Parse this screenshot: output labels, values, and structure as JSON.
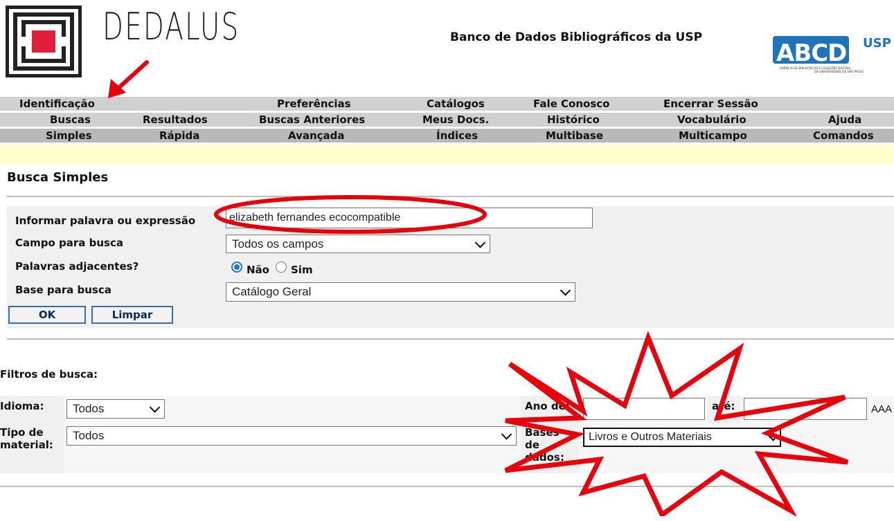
{
  "header": {
    "brand_name": "DEDALUS",
    "db_title": "Banco de Dados Bibliográficos da USP",
    "abcd_logo_text": "ABCD",
    "abcd_usp": "USP",
    "abcd_tagline_1": "AGÊNCIA DE BIBLIOTECAS E COLEÇÕES DIGITAIS",
    "abcd_tagline_2": "DA UNIVERSIDADE DE SÃO PAULO",
    "logo_color": "#e31e3a"
  },
  "menu": {
    "row1": [
      "Identificação",
      "Preferências",
      "Catálogos",
      "Fale Conosco",
      "Encerrar Sessão"
    ],
    "row2": [
      "Buscas",
      "Resultados",
      "Buscas Anteriores",
      "Meus Docs.",
      "Histórico",
      "Vocabulário",
      "Ajuda"
    ],
    "row3": [
      "Simples",
      "Rápida",
      "Avançada",
      "Índices",
      "Multibase",
      "Multicampo",
      "Comandos"
    ]
  },
  "busca": {
    "title": "Busca Simples",
    "label_palavra": "Informar palavra ou expressão",
    "query_value": "elizabeth fernandes ecocompatible",
    "label_campo": "Campo para busca",
    "campo_value": "Todos os campos",
    "label_adjacentes": "Palavras adjacentes?",
    "radio_nao": "Não",
    "radio_sim": "Sim",
    "label_base": "Base para busca",
    "base_value": "Catálogo Geral",
    "btn_ok": "OK",
    "btn_limpar": "Limpar"
  },
  "filtros": {
    "title": "Filtros de busca:",
    "label_idioma": "Idioma:",
    "idioma_value": "Todos",
    "label_ano_de": "Ano de:",
    "label_ate": "até:",
    "ano_hint": "AAA",
    "label_tipo_1": "Tipo de",
    "label_tipo_2": "material:",
    "tipo_value": "Todos",
    "label_bases_1": "Bases",
    "label_bases_2": "de",
    "label_bases_3": "dados:",
    "bases_value": "Livros e Outros Materiais"
  },
  "annotation_color": "#e8000b"
}
